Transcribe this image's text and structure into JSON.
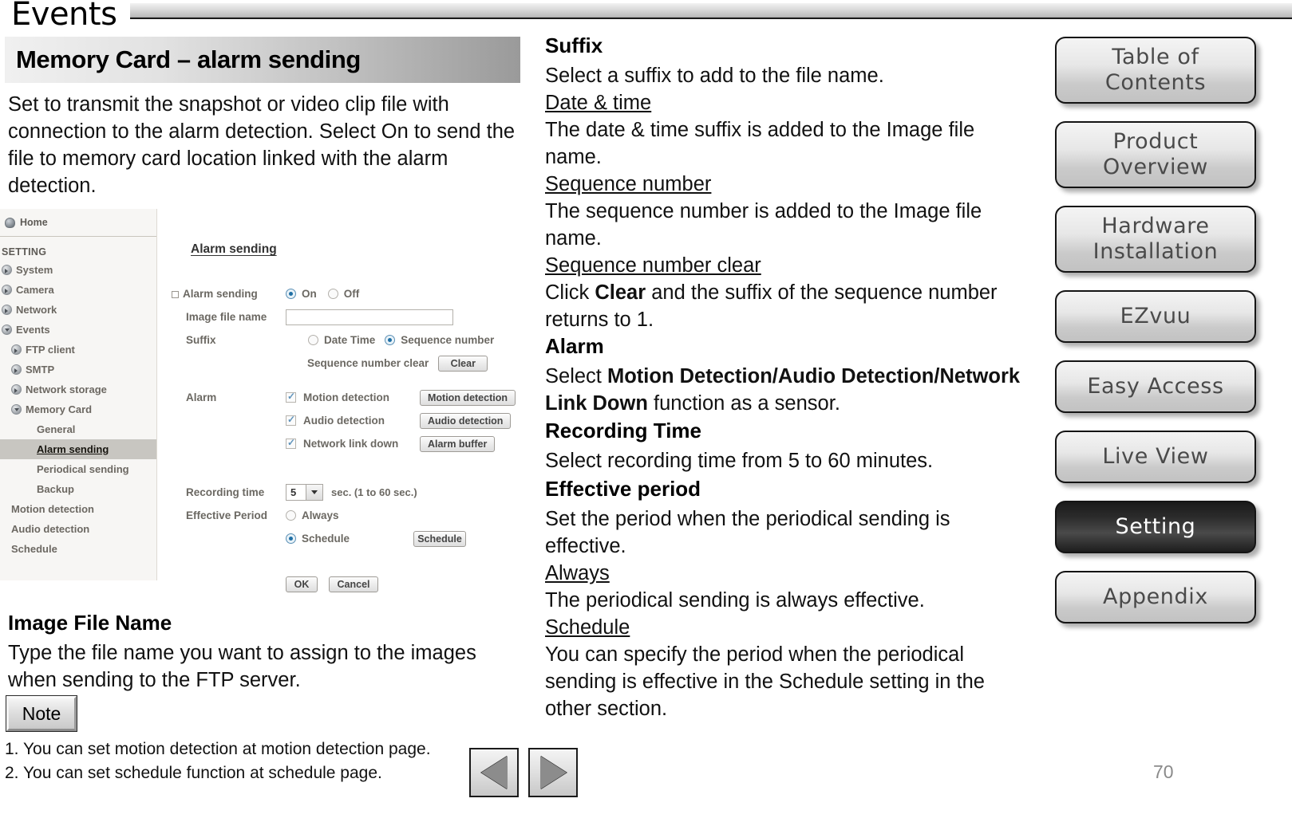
{
  "header": {
    "chapter_title": "Events",
    "banner_title": "Memory Card – alarm sending"
  },
  "intro": "Set to transmit the snapshot or video clip file with connection to the alarm detection. Select On to send the file to memory card location linked with the alarm detection.",
  "screenshot": {
    "home_label": "Home",
    "nav_section_title": "SETTING",
    "nav": [
      {
        "label": "System",
        "level": 1,
        "caret": "right"
      },
      {
        "label": "Camera",
        "level": 1,
        "caret": "right"
      },
      {
        "label": "Network",
        "level": 1,
        "caret": "right"
      },
      {
        "label": "Events",
        "level": 1,
        "caret": "down"
      },
      {
        "label": "FTP client",
        "level": 2,
        "caret": "right"
      },
      {
        "label": "SMTP",
        "level": 2,
        "caret": "right"
      },
      {
        "label": "Network storage",
        "level": 2,
        "caret": "right"
      },
      {
        "label": "Memory Card",
        "level": 2,
        "caret": "down"
      },
      {
        "label": "General",
        "level": 3,
        "caret": "none"
      },
      {
        "label": "Alarm sending",
        "level": 3,
        "caret": "none",
        "active": true
      },
      {
        "label": "Periodical sending",
        "level": 3,
        "caret": "none"
      },
      {
        "label": "Backup",
        "level": 3,
        "caret": "none"
      },
      {
        "label": "Motion detection",
        "level": 2,
        "caret": "none"
      },
      {
        "label": "Audio detection",
        "level": 2,
        "caret": "none"
      },
      {
        "label": "Schedule",
        "level": 2,
        "caret": "none"
      }
    ],
    "panel_title": "Alarm sending",
    "form": {
      "alarm_sending_label": "Alarm sending",
      "alarm_on_label": "On",
      "alarm_off_label": "Off",
      "alarm_selected": "On",
      "image_file_name_label": "Image file name",
      "image_file_name_value": "",
      "suffix_label": "Suffix",
      "suffix_date_time_label": "Date Time",
      "suffix_sequence_label": "Sequence number",
      "suffix_selected": "Sequence number",
      "sequence_clear_label": "Sequence number clear",
      "clear_button": "Clear",
      "alarm_label": "Alarm",
      "alarm_items": [
        {
          "label": "Motion detection",
          "checked": true,
          "button": "Motion detection"
        },
        {
          "label": "Audio detection",
          "checked": true,
          "button": "Audio detection"
        },
        {
          "label": "Network link down",
          "checked": true,
          "button": "Alarm buffer"
        }
      ],
      "recording_time_label": "Recording time",
      "recording_time_value": "5",
      "recording_time_hint": "sec. (1 to 60 sec.)",
      "effective_period_label": "Effective Period",
      "always_label": "Always",
      "schedule_label": "Schedule",
      "schedule_button": "Schedule",
      "effective_selected": "Schedule",
      "ok_button": "OK",
      "cancel_button": "Cancel"
    }
  },
  "left_sections": {
    "image_file_name_heading": "Image File Name",
    "image_file_name_body": "Type the file name you want to assign to the images when sending to the FTP server.",
    "note_button": "Note",
    "notes": [
      "1. You can set motion detection at motion detection page.",
      "2. You can set schedule function at schedule page."
    ]
  },
  "right_sections": {
    "suffix_heading": "Suffix",
    "suffix_body": "Select a suffix to add to the file name.",
    "date_time_sub": "Date & time",
    "date_time_body": "The date & time suffix is added to the Image file name.",
    "sequence_sub": "Sequence number",
    "sequence_body": "The sequence number is added to the Image file name.",
    "sequence_clear_sub": "Sequence number clear",
    "sequence_clear_body_pre": "Click ",
    "sequence_clear_body_bold": "Clear",
    "sequence_clear_body_post": " and the suffix of the sequence number returns to 1.",
    "alarm_heading": "Alarm",
    "alarm_body_pre": "Select ",
    "alarm_body_bold": "Motion Detection/Audio Detection/Network Link Down",
    "alarm_body_post": "  function as a sensor.",
    "recording_heading": "Recording Time",
    "recording_body": "Select recording time from 5 to 60 minutes.",
    "effective_heading": "Effective period",
    "effective_body": "Set the period when the periodical sending is effective.",
    "always_sub": "Always",
    "always_body": "The periodical sending is always effective.",
    "schedule_sub": "Schedule",
    "schedule_body": "You can specify the period when the periodical sending is effective in the Schedule setting in the other section."
  },
  "side_buttons": [
    {
      "label": "Table of Contents",
      "lines": [
        "Table of",
        "Contents"
      ],
      "active": false
    },
    {
      "label": "Product Overview",
      "lines": [
        "Product",
        "Overview"
      ],
      "active": false
    },
    {
      "label": "Hardware Installation",
      "lines": [
        "Hardware",
        "Installation"
      ],
      "active": false
    },
    {
      "label": "EZvuu",
      "lines": [
        "EZvuu"
      ],
      "active": false
    },
    {
      "label": "Easy Access",
      "lines": [
        "Easy Access"
      ],
      "active": false
    },
    {
      "label": "Live View",
      "lines": [
        "Live View"
      ],
      "active": false
    },
    {
      "label": "Setting",
      "lines": [
        "Setting"
      ],
      "active": true
    },
    {
      "label": "Appendix",
      "lines": [
        "Appendix"
      ],
      "active": false
    }
  ],
  "footer": {
    "page_number": "70"
  },
  "nav_arrows": {
    "prev": "previous-page",
    "next": "next-page"
  }
}
